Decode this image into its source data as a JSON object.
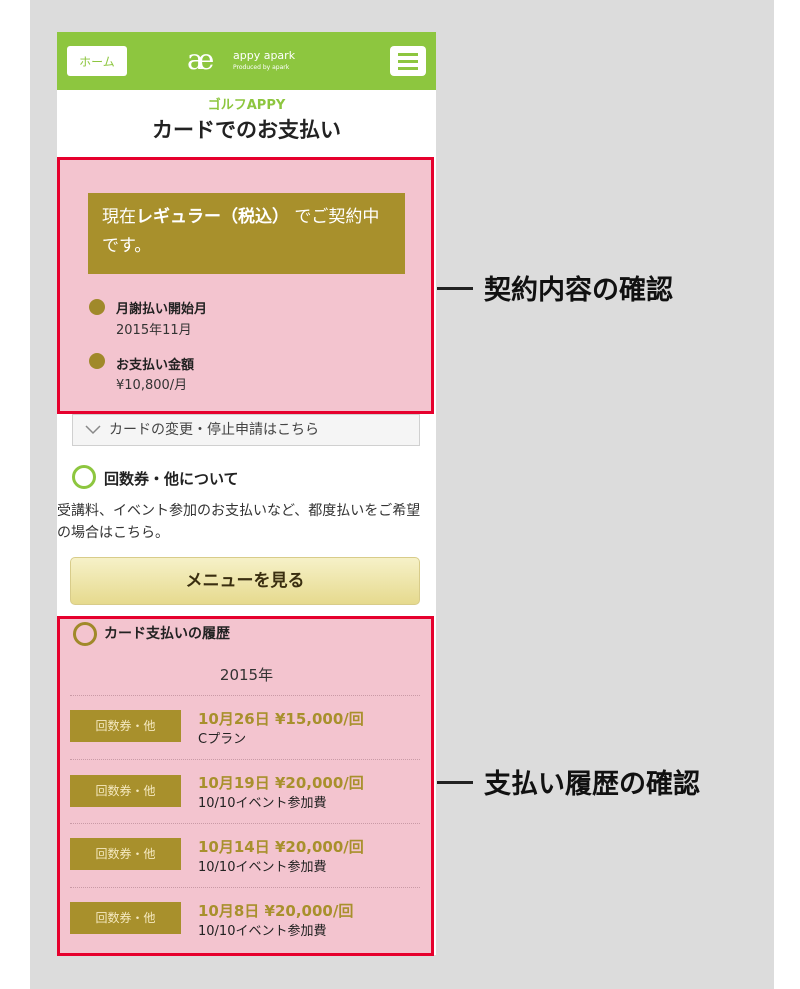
{
  "header": {
    "home_label": "ホーム",
    "logo_mark": "ae",
    "logo_text": "appy apark",
    "logo_sub": "Produced by apark"
  },
  "page": {
    "subtitle": "ゴルフAPPY",
    "title": "カードでのお支払い"
  },
  "contract": {
    "status_pre": "現在",
    "status_plan": "レギュラー（税込）",
    "status_post": "でご契約中です。",
    "start_label": "月謝払い開始月",
    "start_value": "2015年11月",
    "amount_label": "お支払い金額",
    "amount_value": "¥10,800/月",
    "card_link": "カードの変更・停止申請はこちら"
  },
  "tickets": {
    "heading": "回数券・他について",
    "description": "受講料、イベント参加のお支払いなど、都度払いをご希望の場合はこちら。",
    "menu_button": "メニューを見る"
  },
  "history": {
    "heading": "カード支払いの履歴",
    "year": "2015年",
    "rows": [
      {
        "tag": "回数券・他",
        "amount": "10月26日 ¥15,000/回",
        "detail": "Cプラン"
      },
      {
        "tag": "回数券・他",
        "amount": "10月19日 ¥20,000/回",
        "detail": "10/10イベント参加費"
      },
      {
        "tag": "回数券・他",
        "amount": "10月14日 ¥20,000/回",
        "detail": "10/10イベント参加費"
      },
      {
        "tag": "回数券・他",
        "amount": "10月8日 ¥20,000/回",
        "detail": "10/10イベント参加費"
      }
    ]
  },
  "callouts": {
    "contract": "契約内容の確認",
    "history": "支払い履歴の確認"
  },
  "colors": {
    "accent": "#8dc63f",
    "gold": "#a8902c",
    "highlight": "#f3c4cf",
    "border": "#e6002d"
  }
}
